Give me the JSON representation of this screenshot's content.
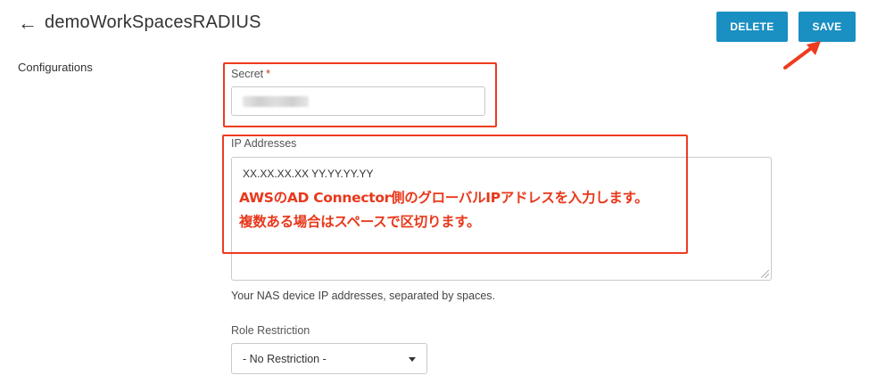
{
  "header": {
    "back_icon": "arrow-left-icon",
    "title": "demoWorkSpacesRADIUS",
    "delete_label": "DELETE",
    "save_label": "SAVE"
  },
  "section": {
    "label": "Configurations"
  },
  "form": {
    "secret": {
      "label": "Secret",
      "required_mark": "*"
    },
    "ip_addresses": {
      "label": "IP Addresses",
      "value": "XX.XX.XX.XX YY.YY.YY.YY",
      "help": "Your NAS device IP addresses, separated by spaces."
    },
    "role_restriction": {
      "label": "Role Restriction",
      "selected": "- No Restriction -"
    }
  },
  "annotation": {
    "line1": "AWSのAD Connector側のグローバルIPアドレスを入力します。",
    "line2": "複数ある場合はスペースで区切ります。"
  },
  "colors": {
    "button": "#1a8fc2",
    "annotation": "#ee3b1f"
  }
}
